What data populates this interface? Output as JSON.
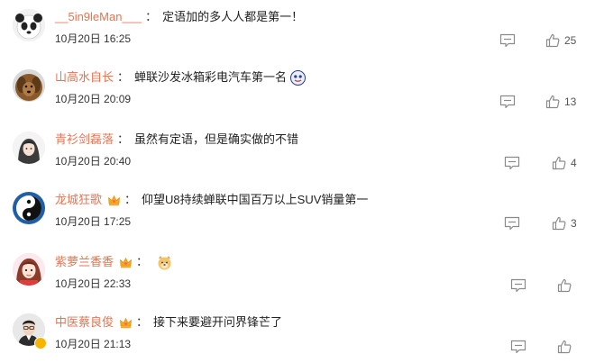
{
  "comments": [
    {
      "username": "__5in9leMan___",
      "colon": "：",
      "text": "定语加的多人人都是第一！",
      "time": "10月20日 16:25",
      "likes": "25"
    },
    {
      "username": "山高水自长",
      "colon": "：",
      "text": "蝉联沙发冰箱彩电汽车第一名",
      "time": "10月20日 20:09",
      "likes": "13"
    },
    {
      "username": "青衫剑磊落",
      "colon": "：",
      "text": "虽然有定语，但是确实做的不错",
      "time": "10月20日 20:40",
      "likes": "4"
    },
    {
      "username": "龙城狂歌",
      "colon": "：",
      "text": "仰望U8持续蝉联中国百万以上SUV销量第一",
      "time": "10月20日 17:25",
      "likes": "3"
    },
    {
      "username": "紫萝兰香香",
      "colon": "：",
      "text": "",
      "time": "10月20日 22:33",
      "likes": ""
    },
    {
      "username": "中医蔡良俊",
      "colon": "：",
      "text": "接下来要避开问界锋芒了",
      "time": "10月20日 21:13",
      "likes": ""
    }
  ],
  "colors": {
    "username": "#eb7350",
    "icon": "#8a8a8a",
    "vip_gold": "#f5a623"
  },
  "icons": {
    "reply": "comment-icon",
    "like": "thumbs-up-icon",
    "vip": "crown-vip-icon"
  }
}
